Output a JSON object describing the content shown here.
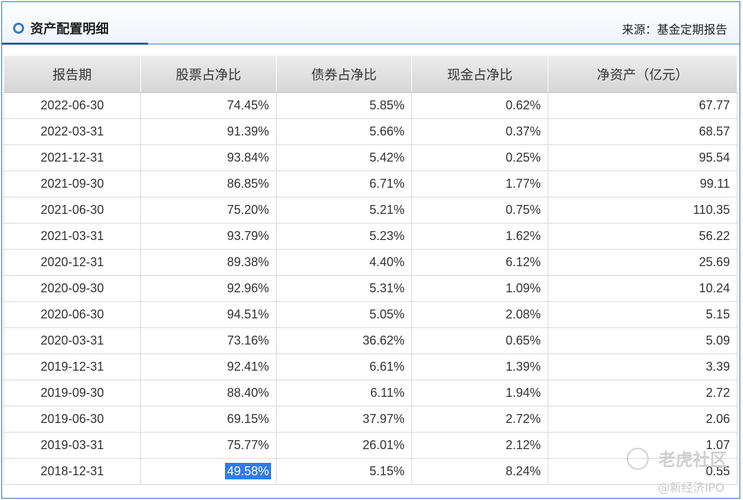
{
  "header": {
    "title": "资产配置明细",
    "source": "来源：基金定期报告"
  },
  "table": {
    "columns": [
      "报告期",
      "股票占净比",
      "债券占净比",
      "现金占净比",
      "净资产（亿元）"
    ],
    "rows": [
      [
        "2022-06-30",
        "74.45%",
        "5.85%",
        "0.62%",
        "67.77"
      ],
      [
        "2022-03-31",
        "91.39%",
        "5.66%",
        "0.37%",
        "68.57"
      ],
      [
        "2021-12-31",
        "93.84%",
        "5.42%",
        "0.25%",
        "95.54"
      ],
      [
        "2021-09-30",
        "86.85%",
        "6.71%",
        "1.77%",
        "99.11"
      ],
      [
        "2021-06-30",
        "75.20%",
        "5.21%",
        "0.75%",
        "110.35"
      ],
      [
        "2021-03-31",
        "93.79%",
        "5.23%",
        "1.62%",
        "56.22"
      ],
      [
        "2020-12-31",
        "89.38%",
        "4.40%",
        "6.12%",
        "25.69"
      ],
      [
        "2020-09-30",
        "92.96%",
        "5.31%",
        "1.09%",
        "10.24"
      ],
      [
        "2020-06-30",
        "94.51%",
        "5.05%",
        "2.08%",
        "5.15"
      ],
      [
        "2020-03-31",
        "73.16%",
        "36.62%",
        "0.65%",
        "5.09"
      ],
      [
        "2019-12-31",
        "92.41%",
        "6.61%",
        "1.39%",
        "3.39"
      ],
      [
        "2019-09-30",
        "88.40%",
        "6.11%",
        "1.94%",
        "2.72"
      ],
      [
        "2019-06-30",
        "69.15%",
        "37.97%",
        "2.72%",
        "2.06"
      ],
      [
        "2019-03-31",
        "75.77%",
        "26.01%",
        "2.12%",
        "1.07"
      ],
      [
        "2018-12-31",
        "49.58%",
        "5.15%",
        "8.24%",
        "0.55"
      ]
    ]
  },
  "watermark": {
    "brand": "老虎社区",
    "handle": "@新经济IPO"
  },
  "colors": {
    "accent": "#2e5f99",
    "highlight": "#2f7be8"
  }
}
